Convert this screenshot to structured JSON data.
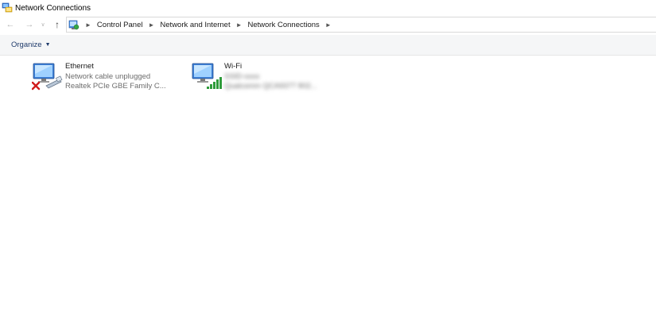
{
  "window": {
    "title": "Network Connections"
  },
  "nav": {
    "breadcrumbs": [
      "Control Panel",
      "Network and Internet",
      "Network Connections"
    ]
  },
  "toolbar": {
    "organize_label": "Organize"
  },
  "connections": [
    {
      "name": "Ethernet",
      "status": "Network cable unplugged",
      "device": "Realtek PCIe GBE Family C...",
      "icon": "ethernet-disconnected-icon"
    },
    {
      "name": "Wi-Fi",
      "status": "SSID-xxxx",
      "device": "Qualcomm QCA9377 802...",
      "icon": "wifi-adapter-icon"
    }
  ],
  "colors": {
    "accent": "#1e3a6a",
    "wifi_signal": "#2e9b3a",
    "error": "#d01c1c"
  }
}
